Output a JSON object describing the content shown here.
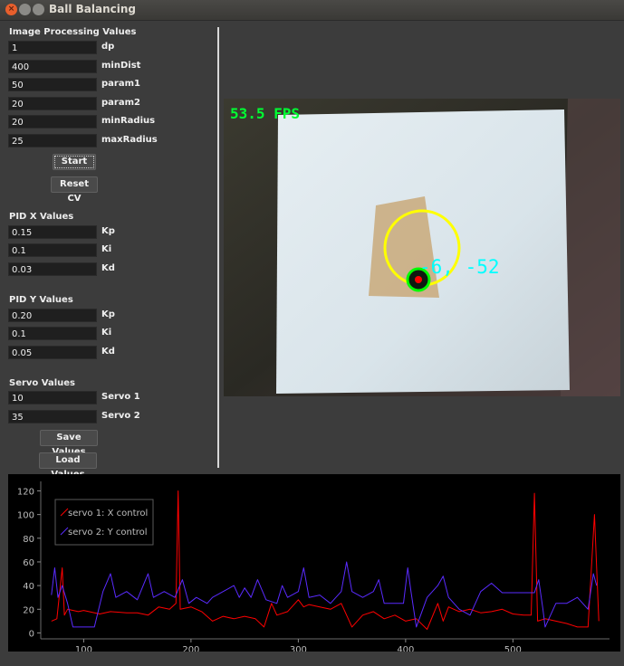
{
  "window": {
    "title": "Ball Balancing"
  },
  "image_processing": {
    "heading": "Image Processing Values",
    "fields": [
      {
        "value": "1",
        "label": "dp"
      },
      {
        "value": "400",
        "label": "minDist"
      },
      {
        "value": "50",
        "label": "param1"
      },
      {
        "value": "20",
        "label": "param2"
      },
      {
        "value": "20",
        "label": "minRadius"
      },
      {
        "value": "25",
        "label": "maxRadius"
      }
    ],
    "start_label": "Start",
    "reset_label": "Reset CV"
  },
  "pid_x": {
    "heading": "PID X Values",
    "fields": [
      {
        "value": "0.15",
        "label": "Kp"
      },
      {
        "value": "0.1",
        "label": "Ki"
      },
      {
        "value": "0.03",
        "label": "Kd"
      }
    ]
  },
  "pid_y": {
    "heading": "PID Y Values",
    "fields": [
      {
        "value": "0.20",
        "label": "Kp"
      },
      {
        "value": "0.1",
        "label": "Ki"
      },
      {
        "value": "0.05",
        "label": "Kd"
      }
    ]
  },
  "servo": {
    "heading": "Servo Values",
    "fields": [
      {
        "value": "10",
        "label": "Servo 1"
      },
      {
        "value": "35",
        "label": "Servo 2"
      }
    ],
    "save_label": "Save Values",
    "load_label": "Load Values"
  },
  "camera": {
    "fps_text": "53.5 FPS",
    "ball_coords": "-6, -52",
    "fps_color": "#00ff33",
    "coords_color": "#00ffff",
    "circle_color": "#ffff00",
    "ball_ring_color": "#00ff00",
    "ball_center_color": "#ff0000"
  },
  "chart_data": {
    "type": "line",
    "title": "",
    "xlabel": "",
    "ylabel": "",
    "xlim": [
      60,
      590
    ],
    "ylim": [
      -5,
      128
    ],
    "x_ticks": [
      100,
      200,
      300,
      400,
      500
    ],
    "y_ticks": [
      0,
      20,
      40,
      60,
      80,
      100,
      120
    ],
    "grid": false,
    "legend_placement": "upper-left",
    "series": [
      {
        "name": "servo 1: X control",
        "color": "#ff0000",
        "points": [
          [
            70,
            10
          ],
          [
            75,
            12
          ],
          [
            80,
            55
          ],
          [
            82,
            15
          ],
          [
            85,
            20
          ],
          [
            95,
            18
          ],
          [
            100,
            19
          ],
          [
            115,
            16
          ],
          [
            125,
            18
          ],
          [
            140,
            17
          ],
          [
            150,
            17
          ],
          [
            160,
            15
          ],
          [
            170,
            22
          ],
          [
            180,
            20
          ],
          [
            186,
            25
          ],
          [
            188,
            120
          ],
          [
            190,
            20
          ],
          [
            200,
            22
          ],
          [
            210,
            18
          ],
          [
            220,
            10
          ],
          [
            230,
            14
          ],
          [
            240,
            12
          ],
          [
            250,
            14
          ],
          [
            260,
            12
          ],
          [
            268,
            5
          ],
          [
            275,
            25
          ],
          [
            280,
            15
          ],
          [
            290,
            18
          ],
          [
            300,
            28
          ],
          [
            305,
            22
          ],
          [
            310,
            24
          ],
          [
            320,
            22
          ],
          [
            330,
            20
          ],
          [
            340,
            25
          ],
          [
            350,
            5
          ],
          [
            360,
            15
          ],
          [
            370,
            18
          ],
          [
            380,
            12
          ],
          [
            390,
            15
          ],
          [
            400,
            10
          ],
          [
            410,
            12
          ],
          [
            420,
            3
          ],
          [
            430,
            25
          ],
          [
            435,
            10
          ],
          [
            440,
            22
          ],
          [
            450,
            18
          ],
          [
            460,
            20
          ],
          [
            470,
            17
          ],
          [
            480,
            18
          ],
          [
            490,
            20
          ],
          [
            500,
            16
          ],
          [
            510,
            15
          ],
          [
            517,
            15
          ],
          [
            520,
            118
          ],
          [
            523,
            10
          ],
          [
            530,
            12
          ],
          [
            540,
            10
          ],
          [
            550,
            8
          ],
          [
            560,
            5
          ],
          [
            570,
            5
          ],
          [
            576,
            100
          ],
          [
            580,
            10
          ]
        ]
      },
      {
        "name": "servo 2: Y control",
        "color": "#5a2bff",
        "points": [
          [
            70,
            32
          ],
          [
            73,
            55
          ],
          [
            76,
            30
          ],
          [
            80,
            40
          ],
          [
            85,
            25
          ],
          [
            90,
            5
          ],
          [
            100,
            5
          ],
          [
            110,
            5
          ],
          [
            118,
            35
          ],
          [
            125,
            50
          ],
          [
            130,
            30
          ],
          [
            140,
            35
          ],
          [
            150,
            28
          ],
          [
            160,
            50
          ],
          [
            165,
            30
          ],
          [
            175,
            35
          ],
          [
            185,
            30
          ],
          [
            192,
            45
          ],
          [
            198,
            25
          ],
          [
            205,
            30
          ],
          [
            215,
            25
          ],
          [
            220,
            30
          ],
          [
            230,
            35
          ],
          [
            240,
            40
          ],
          [
            245,
            30
          ],
          [
            250,
            38
          ],
          [
            256,
            30
          ],
          [
            262,
            45
          ],
          [
            270,
            28
          ],
          [
            280,
            25
          ],
          [
            285,
            40
          ],
          [
            290,
            30
          ],
          [
            300,
            35
          ],
          [
            305,
            55
          ],
          [
            310,
            30
          ],
          [
            320,
            32
          ],
          [
            330,
            25
          ],
          [
            340,
            35
          ],
          [
            345,
            60
          ],
          [
            350,
            35
          ],
          [
            360,
            30
          ],
          [
            370,
            35
          ],
          [
            375,
            45
          ],
          [
            380,
            25
          ],
          [
            390,
            25
          ],
          [
            398,
            25
          ],
          [
            402,
            55
          ],
          [
            405,
            35
          ],
          [
            410,
            5
          ],
          [
            420,
            30
          ],
          [
            430,
            40
          ],
          [
            435,
            48
          ],
          [
            440,
            30
          ],
          [
            450,
            20
          ],
          [
            460,
            15
          ],
          [
            470,
            35
          ],
          [
            480,
            42
          ],
          [
            490,
            34
          ],
          [
            500,
            34
          ],
          [
            510,
            34
          ],
          [
            520,
            34
          ],
          [
            524,
            45
          ],
          [
            528,
            20
          ],
          [
            530,
            5
          ],
          [
            540,
            25
          ],
          [
            550,
            25
          ],
          [
            560,
            30
          ],
          [
            570,
            20
          ],
          [
            575,
            50
          ],
          [
            578,
            40
          ]
        ]
      }
    ]
  }
}
